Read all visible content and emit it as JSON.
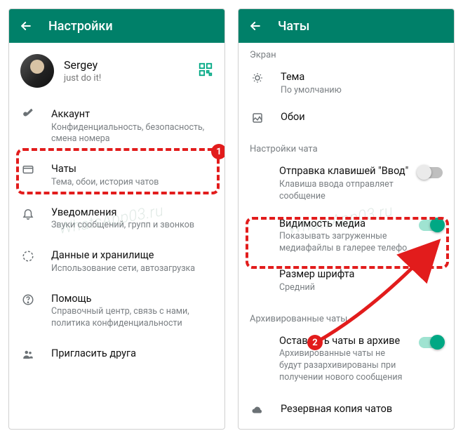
{
  "left": {
    "header": {
      "title": "Настройки"
    },
    "profile": {
      "name": "Sergey",
      "status": "just do it!"
    },
    "items": [
      {
        "title": "Аккаунт",
        "desc": "Конфиденциальность, безопасность, смена номера"
      },
      {
        "title": "Чаты",
        "desc": "Тема, обои, история чатов"
      },
      {
        "title": "Уведомления",
        "desc": "Звуки сообщений, групп и звонков"
      },
      {
        "title": "Данные и хранилище",
        "desc": "Использование сети, автозагрузка"
      },
      {
        "title": "Помощь",
        "desc": "Справочный центр, связь с нами, политика конфиденциальности"
      },
      {
        "title": "Пригласить друга"
      }
    ]
  },
  "right": {
    "header": {
      "title": "Чаты"
    },
    "section_screen": "Экран",
    "theme": {
      "title": "Тема",
      "desc": "По умолчанию"
    },
    "wallpaper": {
      "title": "Обои"
    },
    "section_chat": "Настройки чата",
    "enter_send": {
      "title": "Отправка клавишей \"Ввод\"",
      "desc": "Клавиша ввода отправляет сообщение"
    },
    "media_vis": {
      "title": "Видимость медиа",
      "desc": "Показывать загруженные медиафайлы в галерее телефо"
    },
    "font_size": {
      "title": "Размер шрифта",
      "desc": "Средний"
    },
    "section_archive": "Архивированные чаты",
    "keep_archived": {
      "title": "Оставлять чаты в архиве",
      "desc": "Архивированные чаты не будут разархивированы при получении нового сообщения"
    },
    "backup": {
      "title": "Резервная копия чатов"
    }
  },
  "annotations": {
    "badge1": "1",
    "badge2": "2",
    "watermark": "WhatsApp03.ru"
  }
}
